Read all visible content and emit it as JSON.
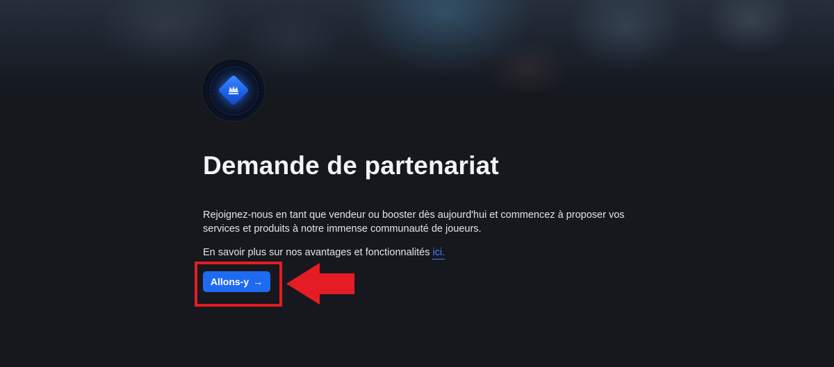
{
  "hero": {
    "image": "game-characters-banner"
  },
  "logo": {
    "icon": "blue-diamond-crown-logo",
    "accent": "#1f6bf0"
  },
  "main": {
    "title": "Demande de partenariat",
    "description": "Rejoignez-nous en tant que vendeur ou booster dès aujourd'hui et commencez à proposer vos services et produits à notre immense communauté de joueurs.",
    "more_prefix": "En savoir plus sur nos avantages et fonctionnalités",
    "more_link": "ici.",
    "cta_label": "Allons-y",
    "cta_arrow": "→"
  },
  "annotation": {
    "box_color": "#e51c24",
    "arrow_color": "#e51c24"
  }
}
